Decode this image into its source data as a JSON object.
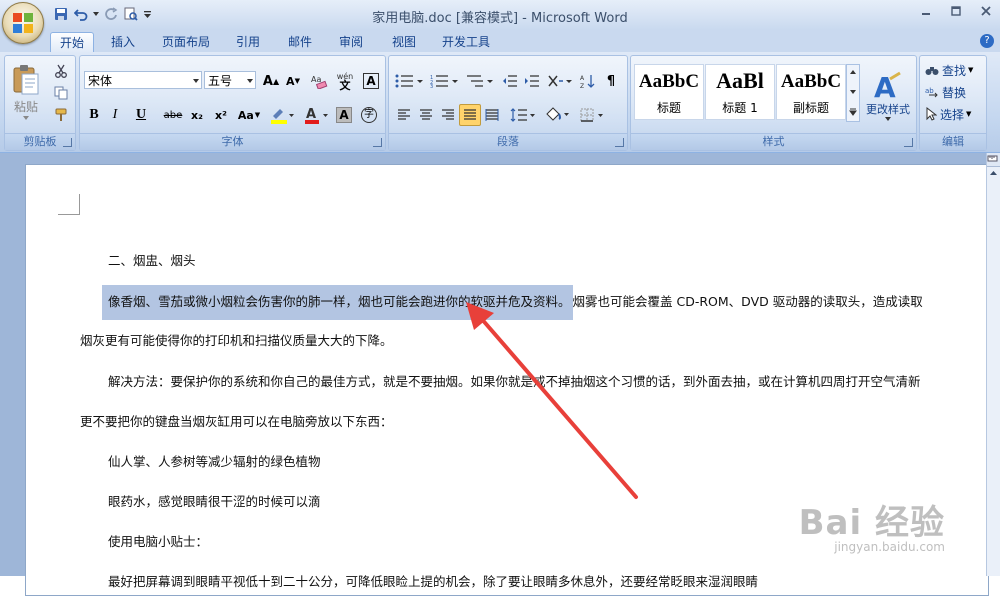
{
  "window": {
    "title": "家用电脑.doc [兼容模式] - Microsoft Word"
  },
  "tabs": [
    "开始",
    "插入",
    "页面布局",
    "引用",
    "邮件",
    "审阅",
    "视图",
    "开发工具"
  ],
  "active_tab": "开始",
  "ribbon": {
    "clipboard": {
      "paste_label": "粘贴",
      "group_label": "剪贴板"
    },
    "font": {
      "font_name": "宋体",
      "font_size": "五号",
      "group_label": "字体",
      "bold": "B",
      "italic": "I",
      "underline": "U",
      "strike": "abe",
      "subscript": "x₂",
      "superscript": "x²",
      "change_case": "Aa",
      "wen": "wén",
      "char": "A"
    },
    "paragraph": {
      "group_label": "段落"
    },
    "styles": {
      "group_label": "样式",
      "items": [
        {
          "sample": "AaBbC",
          "name": "标题"
        },
        {
          "sample": "AaBl",
          "name": "标题 1"
        },
        {
          "sample": "AaBbC",
          "name": "副标题"
        }
      ],
      "change_styles_label": "更改样式"
    },
    "editing": {
      "group_label": "编辑",
      "find": "查找",
      "replace": "替换",
      "select": "选择"
    }
  },
  "document": {
    "lines": [
      "二、烟盅、烟头",
      "像香烟、雪茄或微小烟粒会伤害你的肺一样，烟也可能会跑进你的软驱并危及资料。",
      "烟雾也可能会覆盖 CD-ROM、DVD 驱动器的读取头，造成读取",
      "烟灰更有可能使得你的打印机和扫描仪质量大大的下降。",
      "解决方法：要保护你的系统和你自己的最佳方式，就是不要抽烟。如果你就是戒不掉抽烟这个习惯的话，到外面去抽，或在计算机四周打开空气清新",
      "更不要把你的键盘当烟灰缸用可以在电脑旁放以下东西：",
      "仙人掌、人参树等减少辐射的绿色植物",
      "眼药水，感觉眼睛很干涩的时候可以滴",
      "使用电脑小贴士：",
      "最好把屏幕调到眼睛平视低十到二十公分，可降低眼睑上提的机会，除了要让眼睛多休息外，还要经常眨眼来湿润眼睛"
    ]
  },
  "watermark": {
    "main": "Bai 经验",
    "sub": "jingyan.baidu.com"
  },
  "colors": {
    "selection": "#b3c5e2",
    "arrow": "#e8403a",
    "ribbon": "#c3d6ef"
  }
}
